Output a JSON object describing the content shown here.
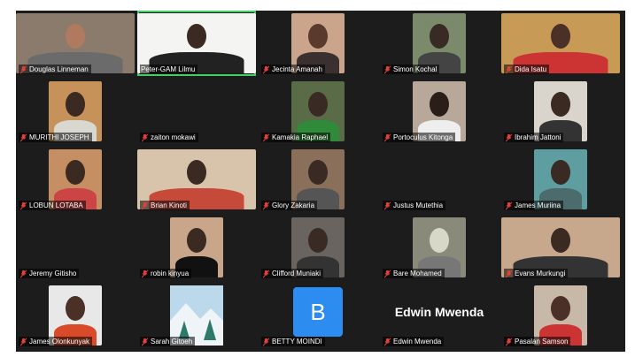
{
  "participants": [
    {
      "name": "Douglas Linneman",
      "muted": true,
      "active": false
    },
    {
      "name": "Peter-GAM Lilmu",
      "muted": false,
      "active": true
    },
    {
      "name": "Jecinta Amanah",
      "muted": true,
      "active": false
    },
    {
      "name": "Simon Kochal",
      "muted": true,
      "active": false
    },
    {
      "name": "Dida Isatu",
      "muted": true,
      "active": false
    },
    {
      "name": "MURITHI JOSEPH",
      "muted": true,
      "active": false
    },
    {
      "name": "zaiton mokawi",
      "muted": true,
      "active": false
    },
    {
      "name": "Kamakia Raphael",
      "muted": true,
      "active": false
    },
    {
      "name": "Portoculus Kitonga",
      "muted": true,
      "active": false
    },
    {
      "name": "Ibrahim Jattoni",
      "muted": true,
      "active": false
    },
    {
      "name": "LOBUN LOTABA",
      "muted": true,
      "active": false
    },
    {
      "name": "Brian Kinoti",
      "muted": true,
      "active": false
    },
    {
      "name": "Glory Zakaria",
      "muted": true,
      "active": false
    },
    {
      "name": "Justus Mutethia",
      "muted": true,
      "active": false
    },
    {
      "name": "James Muriina",
      "muted": true,
      "active": false
    },
    {
      "name": "Jeremy Gitisho",
      "muted": true,
      "active": false
    },
    {
      "name": "robin kinyua",
      "muted": true,
      "active": false
    },
    {
      "name": "Clifford Muniaki",
      "muted": true,
      "active": false
    },
    {
      "name": "Bare Mohamed",
      "muted": true,
      "active": false
    },
    {
      "name": "Evans Murkungi",
      "muted": true,
      "active": false
    },
    {
      "name": "James Olonkunyak",
      "muted": true,
      "active": false
    },
    {
      "name": "Sarah Gitoeh",
      "muted": true,
      "active": false
    },
    {
      "name": "BETTY MOINDI",
      "muted": true,
      "active": false,
      "initial": "B"
    },
    {
      "name": "Edwin Mwenda",
      "muted": true,
      "active": false,
      "display_name": "Edwin Mwenda"
    },
    {
      "name": "Pasalan Samson",
      "muted": true,
      "active": false
    }
  ],
  "colors": {
    "background": "#1c1c1c",
    "active_border": "#3fd06a",
    "mute_icon": "#e0403a",
    "avatar_blue": "#2d8cf0"
  }
}
